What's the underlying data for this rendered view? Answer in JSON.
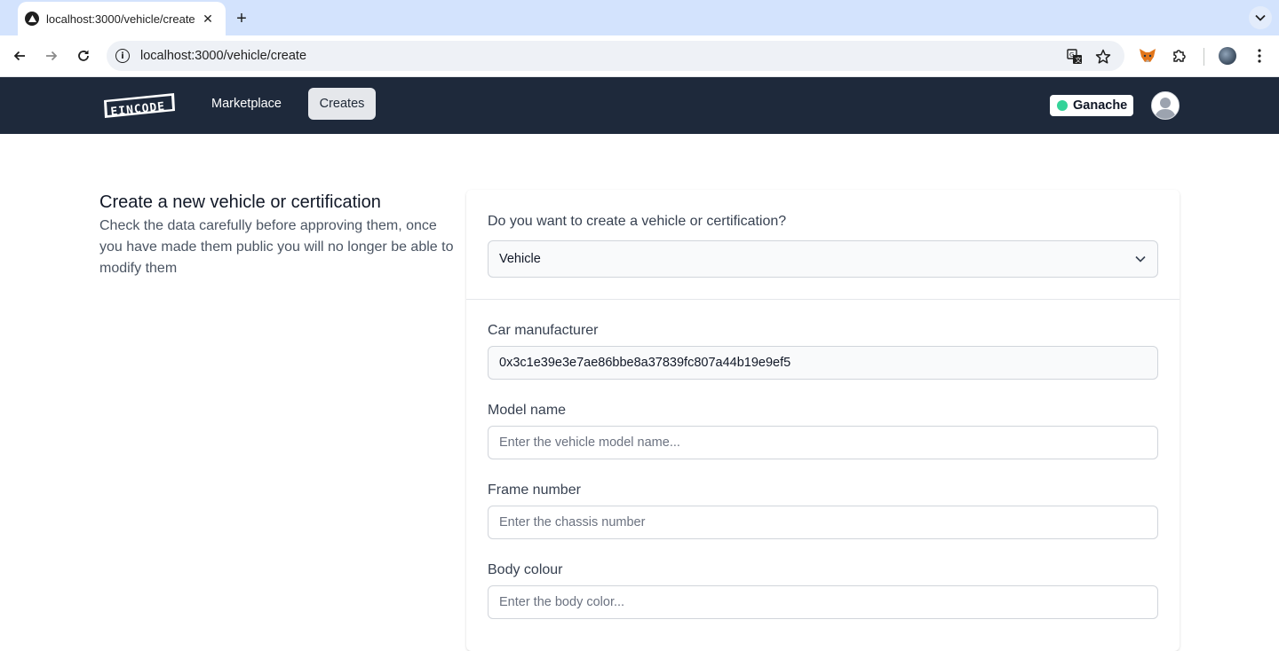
{
  "browser": {
    "tab_title": "localhost:3000/vehicle/create",
    "url": "localhost:3000/vehicle/create",
    "icons": [
      "back-arrow-icon",
      "forward-arrow-icon",
      "reload-icon",
      "site-info-icon",
      "translate-icon",
      "bookmark-star-icon",
      "metamask-fox-icon",
      "extensions-puzzle-icon",
      "profile-icon",
      "kebab-menu-icon"
    ]
  },
  "header": {
    "logo_alt": "EINCODE",
    "nav": [
      {
        "label": "Marketplace"
      },
      {
        "label": "Creates"
      }
    ],
    "network": {
      "label": "Ganache",
      "status_color": "#34d399"
    }
  },
  "intro": {
    "title": "Create a new vehicle or certification",
    "description": "Check the data carefully before approving them, once you have made them public you will no longer be able to modify them"
  },
  "form": {
    "type_question": "Do you want to create a vehicle or certification?",
    "type_selected": "Vehicle",
    "fields": [
      {
        "label": "Car manufacturer",
        "value": "0x3c1e39e3e7ae86bbe8a37839fc807a44b19e9ef5",
        "placeholder": ""
      },
      {
        "label": "Model name",
        "value": "",
        "placeholder": "Enter the vehicle model name..."
      },
      {
        "label": "Frame number",
        "value": "",
        "placeholder": "Enter the chassis number"
      },
      {
        "label": "Body colour",
        "value": "",
        "placeholder": "Enter the body color..."
      }
    ]
  },
  "colors": {
    "appbar_bg": "#1e293b",
    "accent_active_nav": "#e5e7eb"
  }
}
